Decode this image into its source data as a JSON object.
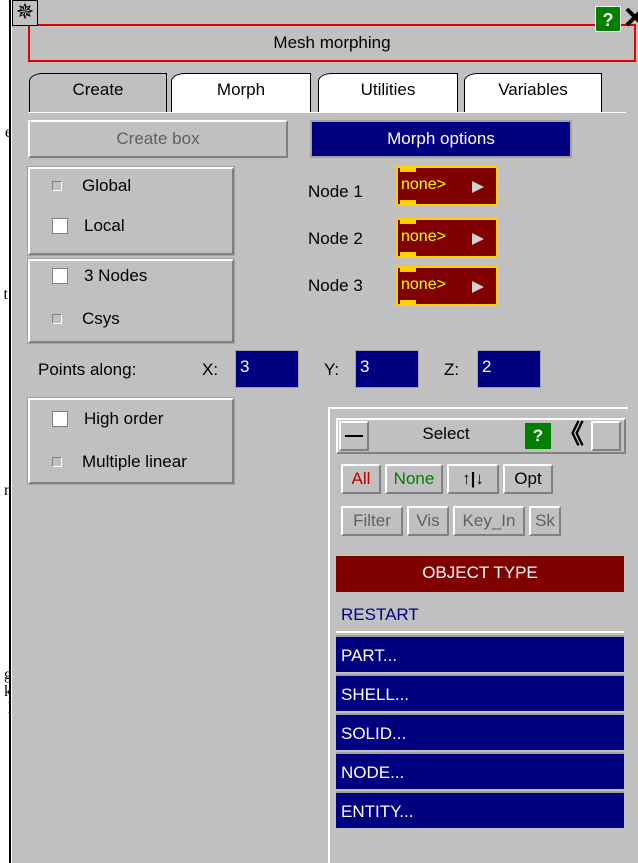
{
  "background_fragments": [
    "e",
    "t.",
    "n",
    "g",
    "k",
    "l"
  ],
  "title": "Mesh morphing",
  "title_help": "?",
  "title_close": "✕",
  "title_star": "✵",
  "tabs": [
    "Create",
    "Morph",
    "Utilities",
    "Variables"
  ],
  "buttons": {
    "create_box": "Create box",
    "morph_options": "Morph options"
  },
  "frame": {
    "global": "Global",
    "local": "Local"
  },
  "define": {
    "three_nodes": "3 Nodes",
    "csys": "Csys"
  },
  "nodes": [
    {
      "label": "Node 1",
      "value": "none>"
    },
    {
      "label": "Node 2",
      "value": "none>"
    },
    {
      "label": "Node 3",
      "value": "none>"
    }
  ],
  "points_along": {
    "label": "Points along:",
    "x_label": "X:",
    "x": "3",
    "y_label": "Y:",
    "y": "3",
    "z_label": "Z:",
    "z": "2"
  },
  "order": {
    "high": "High order",
    "multiple": "Multiple linear"
  },
  "select": {
    "title": "Select",
    "help": "?",
    "collapse": "《",
    "all": "All",
    "none": "None",
    "toggle": "↑|↓",
    "opt": "Opt",
    "filter": "Filter",
    "vis": "Vis",
    "key_in": "Key_In",
    "sk": "Sk",
    "object_type_header": "OBJECT TYPE",
    "object_types": [
      "RESTART",
      "PART...",
      "SHELL...",
      "SOLID...",
      "NODE...",
      "ENTITY..."
    ]
  },
  "colors": {
    "panel": "#c0c0c0",
    "navy": "#000080",
    "maroon": "#800000",
    "help_green": "#008000",
    "title_border": "#e00000",
    "node_text": "#ffff00"
  }
}
